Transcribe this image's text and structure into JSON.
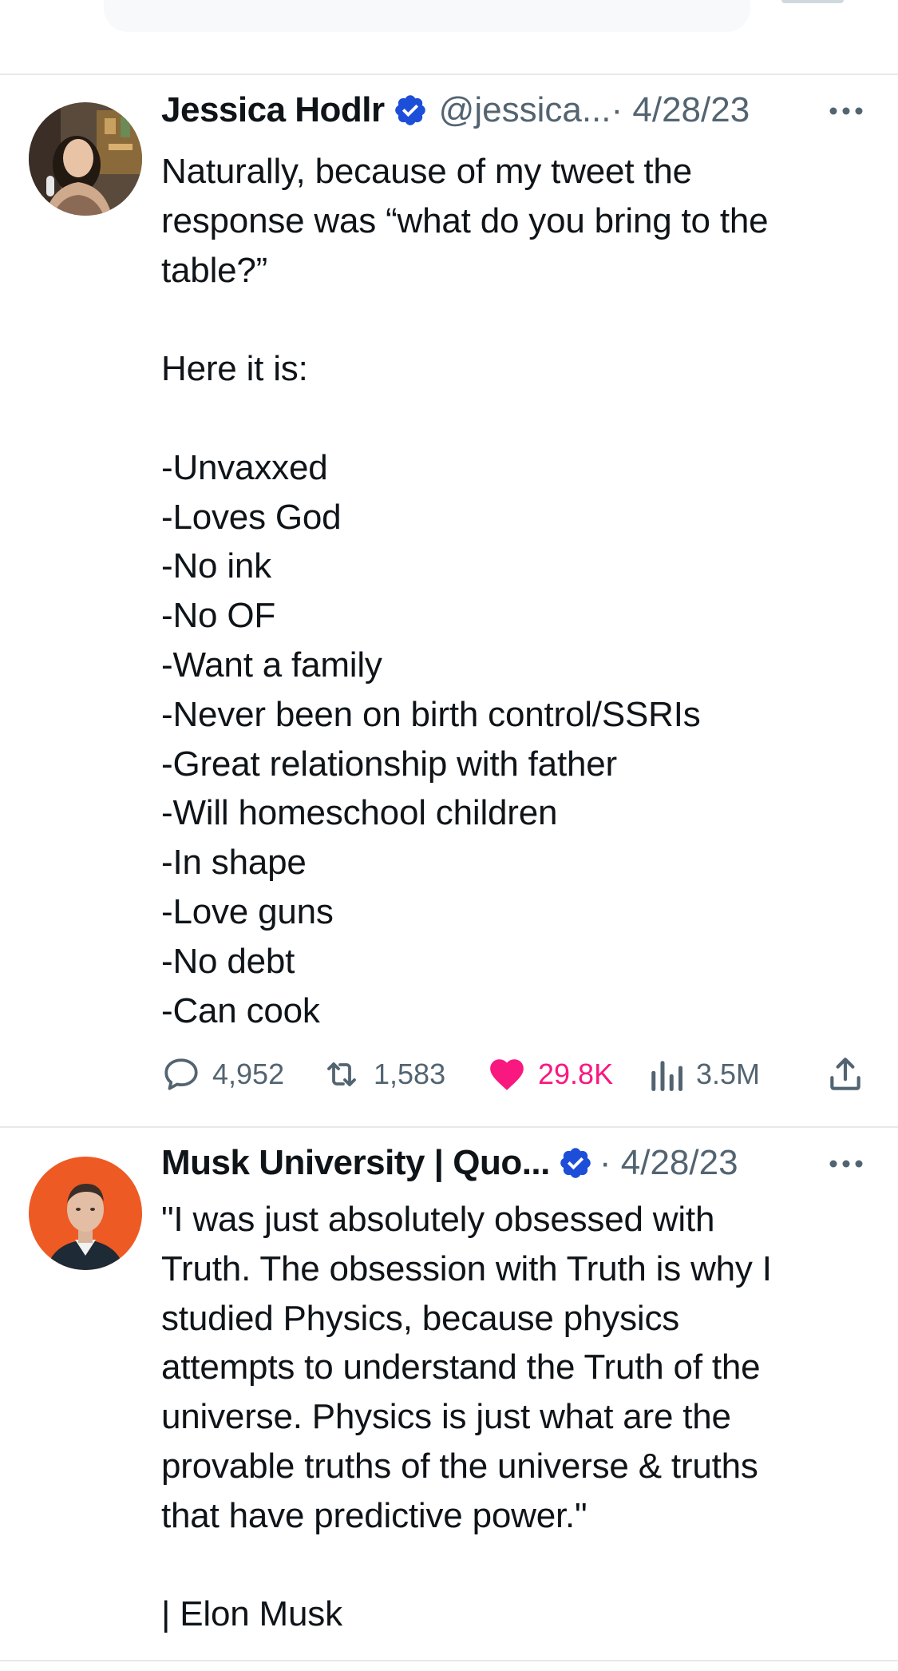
{
  "colors": {
    "text": "#0f1419",
    "secondary": "#536471",
    "divider": "#e6e9eb",
    "verified": "#1d4ed8",
    "like": "#f91880"
  },
  "tweets": [
    {
      "author_name": "Jessica Hodlr",
      "handle": "@jessica...",
      "date": "· 4/28/23",
      "verified": true,
      "avatar": "woman-portrait-avatar",
      "body": "Naturally, because of my tweet the\nresponse was “what do you bring to the\ntable?”\n\nHere it is:\n\n-Unvaxxed\n-Loves God\n-No ink\n-No OF\n-Want a family\n-Never been on birth control/SSRIs\n-Great relationship with father\n-Will homeschool children\n-In shape\n-Love guns\n-No debt\n-Can cook",
      "stats": {
        "replies": "4,952",
        "retweets": "1,583",
        "likes": "29.8K",
        "views": "3.5M"
      },
      "liked": true
    },
    {
      "author_name": "Musk University | Quo...",
      "date": "· 4/28/23",
      "verified": true,
      "avatar": "man-portrait-avatar",
      "body": "\"I was just absolutely obsessed with\nTruth. The obsession with Truth is why I\nstudied Physics, because physics\nattempts to understand the Truth of the\nuniverse. Physics is just what are the\nprovable truths of the universe & truths\nthat have predictive power.\"\n\n| Elon Musk"
    }
  ],
  "icons": {
    "more": "more-horizontal-icon",
    "reply": "reply-icon",
    "retweet": "retweet-icon",
    "like": "heart-icon",
    "views": "views-icon",
    "share": "share-icon",
    "verified": "verified-badge-icon"
  }
}
